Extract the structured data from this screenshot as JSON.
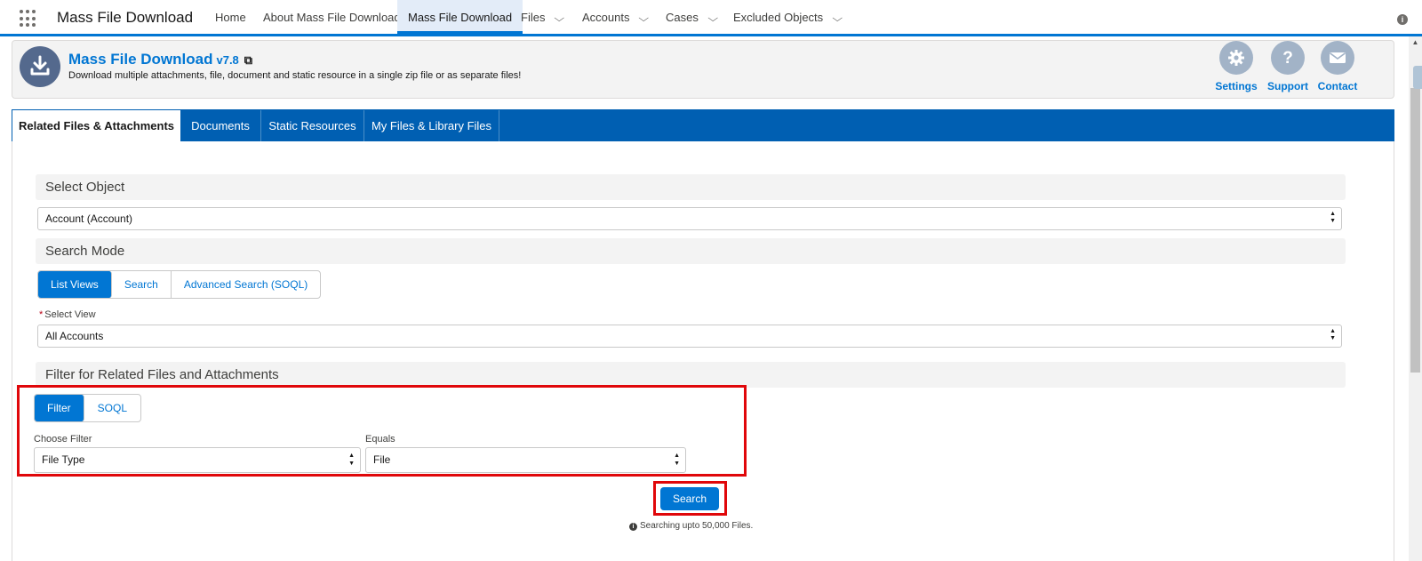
{
  "topnav": {
    "app_name": "Mass File Download",
    "items": [
      {
        "label": "Home",
        "has_menu": false
      },
      {
        "label": "About Mass File Download",
        "has_menu": false
      },
      {
        "label": "Mass File Download",
        "has_menu": false,
        "active": true
      },
      {
        "label": "Files",
        "has_menu": true
      },
      {
        "label": "Accounts",
        "has_menu": true
      },
      {
        "label": "Cases",
        "has_menu": true
      },
      {
        "label": "Excluded Objects",
        "has_menu": true
      }
    ],
    "accent_color": "#0176d3"
  },
  "header": {
    "title": "Mass File Download",
    "version": "v7.8",
    "subtitle": "Download multiple attachments, file, document and static resource in a single zip file or as separate files!",
    "buttons": [
      {
        "label": "Settings",
        "icon": "gear-icon"
      },
      {
        "label": "Support",
        "icon": "question-icon"
      },
      {
        "label": "Contact",
        "icon": "envelope-icon"
      }
    ]
  },
  "tabs": [
    {
      "label": "Related Files & Attachments",
      "active": true
    },
    {
      "label": "Documents"
    },
    {
      "label": "Static Resources"
    },
    {
      "label": "My Files & Library Files"
    }
  ],
  "select_object": {
    "heading": "Select Object",
    "value": "Account (Account)"
  },
  "search_mode": {
    "heading": "Search Mode",
    "options": [
      "List Views",
      "Search",
      "Advanced Search (SOQL)"
    ],
    "selected": "List Views",
    "select_view_label": "Select View",
    "select_view_value": "All Accounts"
  },
  "filter": {
    "heading": "Filter for Related Files and Attachments",
    "modes": [
      "Filter",
      "SOQL"
    ],
    "selected_mode": "Filter",
    "choose_filter_label": "Choose Filter",
    "choose_filter_value": "File Type",
    "equals_label": "Equals",
    "equals_value": "File"
  },
  "search": {
    "button_label": "Search",
    "note": "Searching upto 50,000 Files."
  }
}
